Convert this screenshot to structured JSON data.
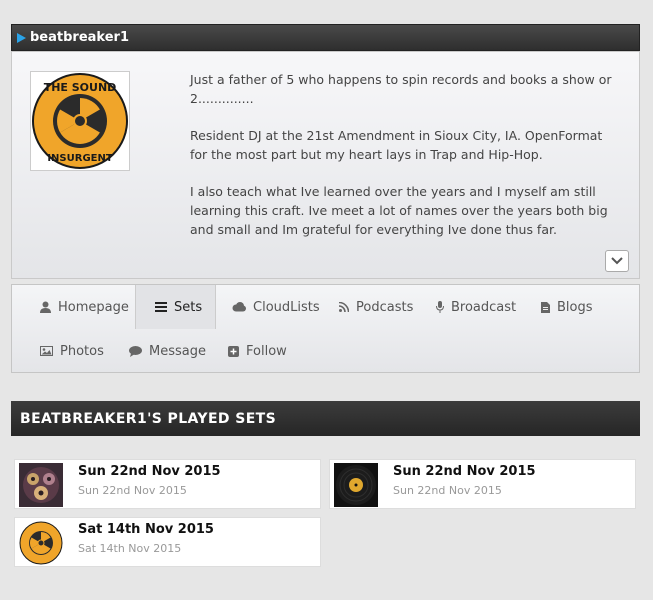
{
  "profile": {
    "name": "beatbreaker1",
    "avatar_text": "THE SOUND INSURGENT",
    "bio": [
      "Just a father of 5 who happens to spin records and books a show or 2..............",
      "Resident DJ at the 21st Amendment in Sioux City, IA. OpenFormat for the most part but my heart lays in Trap and Hip-Hop.",
      "I also teach what Ive learned over the years and I myself am still learning this craft. Ive meet a lot of names over the years both big and small and Im grateful for everything Ive done thus far."
    ]
  },
  "nav": {
    "items": [
      {
        "label": "Homepage",
        "icon": "user-icon"
      },
      {
        "label": "Sets",
        "icon": "list-icon",
        "active": true
      },
      {
        "label": "CloudLists",
        "icon": "cloud-icon"
      },
      {
        "label": "Podcasts",
        "icon": "rss-icon"
      },
      {
        "label": "Broadcast",
        "icon": "microphone-icon"
      },
      {
        "label": "Blogs",
        "icon": "document-icon"
      },
      {
        "label": "Photos",
        "icon": "image-icon"
      },
      {
        "label": "Message",
        "icon": "chat-bubble-icon"
      },
      {
        "label": "Follow",
        "icon": "plus-icon"
      }
    ]
  },
  "sets_section": {
    "title": "BEATBREAKER1'S PLAYED SETS",
    "sets": [
      {
        "title": "Sun 22nd Nov 2015",
        "date": "Sun 22nd Nov 2015",
        "thumb": "vinyl-decks-thumbnail"
      },
      {
        "title": "Sun 22nd Nov 2015",
        "date": "Sun 22nd Nov 2015",
        "thumb": "vinyl-record-thumbnail"
      },
      {
        "title": "Sat 14th Nov 2015",
        "date": "Sat 14th Nov 2015",
        "thumb": "sound-insurgent-logo-thumbnail"
      }
    ]
  },
  "colors": {
    "accent": "#2aa3e8",
    "header_bg": "#2e2e2e",
    "logo_orange": "#f0a52a"
  }
}
